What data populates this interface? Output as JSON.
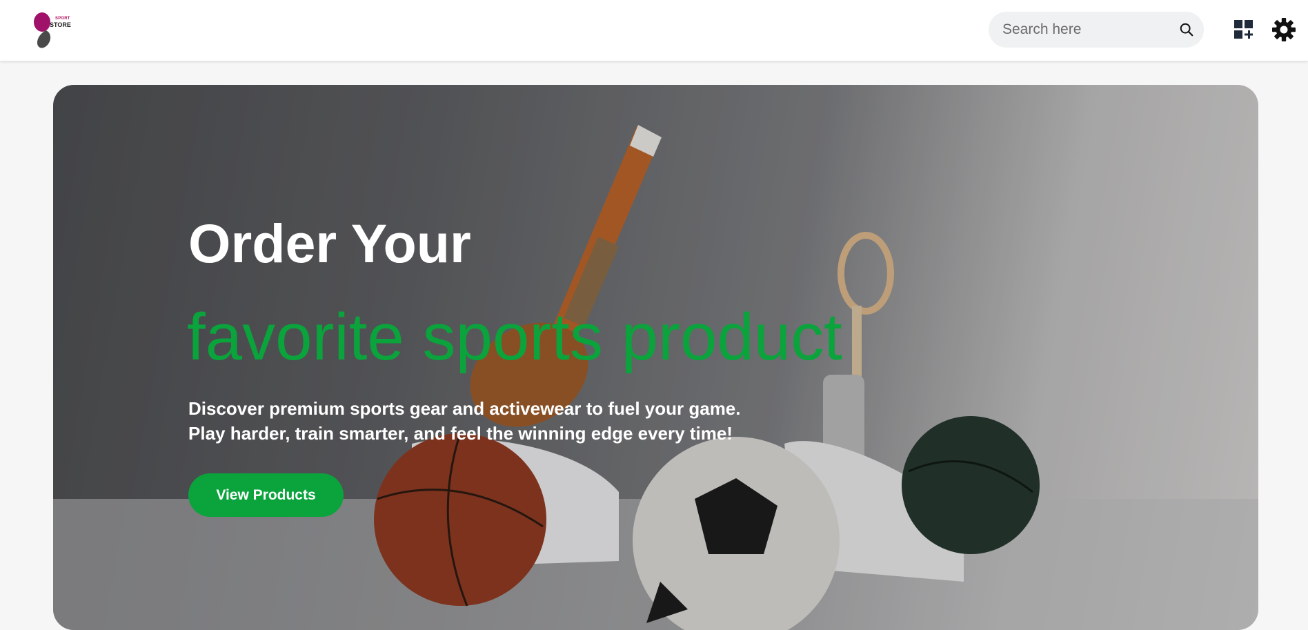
{
  "brand": {
    "logo_line1": "SPORT",
    "logo_line2": "STORE",
    "primary_color": "#b0125f",
    "accent_color": "#0aa33c"
  },
  "header": {
    "search": {
      "placeholder": "Search here",
      "value": "",
      "icon": "search-icon"
    },
    "actions": [
      {
        "icon": "grid-add-icon"
      },
      {
        "icon": "gear-icon"
      }
    ]
  },
  "hero": {
    "title": "Order Your",
    "subtitle": "favorite sports product",
    "description_line1": "Discover premium sports gear and activewear to fuel your game.",
    "description_line2": "Play harder, train smarter, and feel the winning edge every time!",
    "cta_label": "View Products",
    "image": "sports-equipment-photo"
  }
}
